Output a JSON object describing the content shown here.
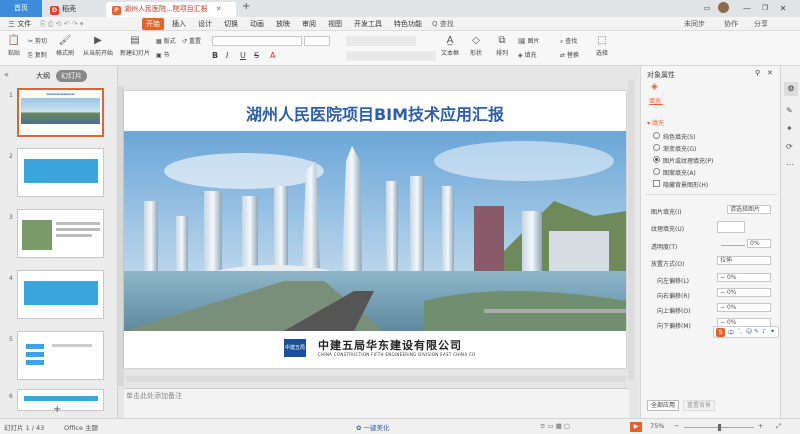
{
  "tabs": {
    "home": "首页",
    "wps": "稻壳",
    "doc": "湖州人民医院...院项目汇报"
  },
  "window": {
    "unsync": "未同步",
    "collab": "协作",
    "share": "分享"
  },
  "menu": {
    "file": "三 文件",
    "items": [
      "开始",
      "插入",
      "设计",
      "切换",
      "动画",
      "放映",
      "审阅",
      "视图",
      "开发工具",
      "特色功能"
    ],
    "search": "Q 查找"
  },
  "ribbon": {
    "paste": "粘贴",
    "cut": "剪切",
    "copy": "复制",
    "format_painter": "格式刷",
    "from_start": "从当前开始",
    "new_slide": "新建幻灯片",
    "layout": "版式",
    "section": "节",
    "reset": "重置",
    "bold": "B",
    "italic": "I",
    "underline": "U",
    "strike": "S",
    "textbox": "文本框",
    "shape": "形状",
    "arrange": "排列",
    "picture": "图片",
    "fill": "填充",
    "find": "查找",
    "replace": "替换",
    "select": "选择"
  },
  "leftpanel": {
    "outline": "大纲",
    "slides": "幻灯片",
    "numbers": [
      "1",
      "2",
      "3",
      "4",
      "5",
      "6"
    ]
  },
  "slide": {
    "title": "湖州人民医院项目BIM技术应用汇报",
    "company": "中建五局华东建设有限公司",
    "company_en": "CHINA CONSTRUCTION FIFTH ENGINEERING DIVISION EAST CHINA CO",
    "logo": "中建五局"
  },
  "notes": "单击此处添加备注",
  "rightpanel": {
    "title": "对象属性",
    "tab": "填充",
    "section": "填充",
    "options": [
      "纯色填充(S)",
      "渐变填充(G)",
      "图片或纹理填充(P)",
      "图案填充(A)",
      "隐藏背景图形(H)"
    ],
    "picfill_label": "图片填充(I)",
    "picfill_value": "请选择图片",
    "texture_label": "纹理填充(U)",
    "transparency_label": "透明度(T)",
    "transparency_value": "0%",
    "mode_label": "放置方式(O)",
    "mode_value": "拉伸",
    "offset_left": "向左偏移(L)",
    "offset_right": "向右偏移(R)",
    "offset_up": "向上偏移(O)",
    "offset_down": "向下偏移(M)",
    "offset_value": "0%",
    "apply_all": "全部应用",
    "reset_bg": "重置背景"
  },
  "status": {
    "slide": "幻灯片 1 / 43",
    "theme": "Office 主题",
    "beautify": "一键美化",
    "zoom": "75%"
  },
  "ime": [
    "中",
    "ʻ,",
    "☺",
    "✎",
    "♪",
    "✦"
  ],
  "colors": {
    "accent": "#e3632d",
    "blue": "#3d8bd9",
    "title_blue": "#2f5fa8"
  }
}
